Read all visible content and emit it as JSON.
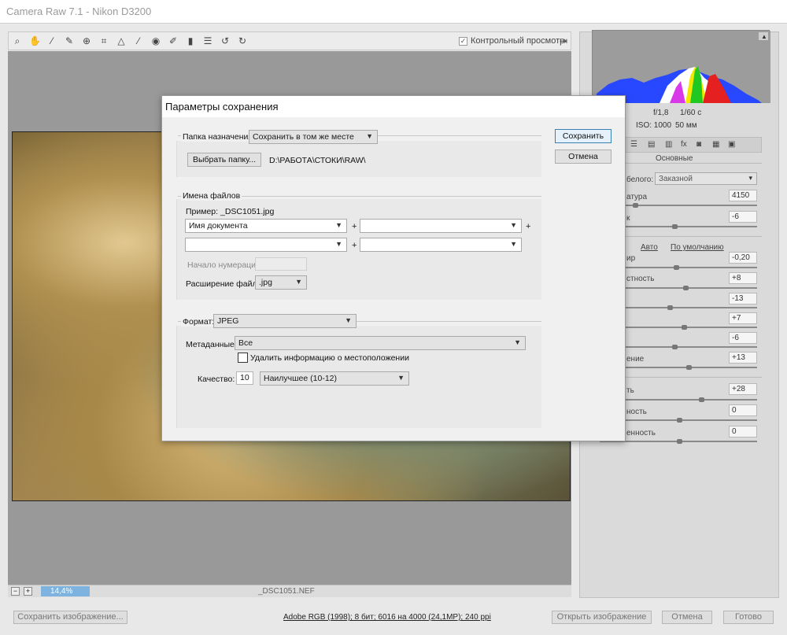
{
  "window": {
    "title": "Camera Raw 7.1  -  Nikon D3200"
  },
  "toolbar": {
    "tools": [
      "zoom-icon",
      "hand-icon",
      "eyedropper-icon",
      "color-sampler-icon",
      "target-adjust-icon",
      "crop-icon",
      "straighten-icon",
      "spot-removal-icon",
      "red-eye-icon",
      "brush-icon",
      "graduated-filter-icon",
      "preferences-icon",
      "rotate-left-icon",
      "rotate-right-icon"
    ],
    "preview_label": "Контрольный просмотр",
    "preview_checked": true
  },
  "status": {
    "zoom": "14,4%",
    "filename": "_DSC1051.NEF"
  },
  "histogram": {
    "aperture": "f/1,8",
    "shutter": "1/60 с",
    "iso": "ISO: 1000",
    "focal": "50 мм"
  },
  "panel": {
    "tab_title": "Основные",
    "wb_label": "белого:",
    "wb_value": "Заказной",
    "auto": "Авто",
    "default": "По умолчанию",
    "rows": [
      {
        "label": "атура",
        "value": "4150"
      },
      {
        "label": "к",
        "value": "-6"
      },
      {
        "label": "ир",
        "value": "-0,20"
      },
      {
        "label": "стность",
        "value": "+8"
      },
      {
        "label": "",
        "value": "-13"
      },
      {
        "label": "",
        "value": "+7"
      },
      {
        "label": "",
        "value": "-6"
      },
      {
        "label": "ение",
        "value": "+13"
      },
      {
        "label": "ть",
        "value": "+28"
      },
      {
        "label": "ность",
        "value": "0"
      },
      {
        "label": "енность",
        "value": "0"
      }
    ]
  },
  "bottom": {
    "save_image": "Сохранить изображение...",
    "info": "Adobe RGB (1998); 8 бит; 6016 на 4000 (24,1МР); 240 ppi",
    "open_image": "Открыть изображение",
    "cancel": "Отмена",
    "done": "Готово"
  },
  "dialog": {
    "title": "Параметры сохранения",
    "save": "Сохранить",
    "cancel": "Отмена",
    "dest_label": "Папка назначения:",
    "dest_value": "Сохранить в том же месте",
    "choose_folder": "Выбрать папку...",
    "folder_path": "D:\\РАБОТА\\СТОКИ\\RAW\\",
    "filenames_caption": "Имена файлов",
    "example_label": "Пример:",
    "example_value": "_DSC1051.jpg",
    "name_part1": "Имя документа",
    "name_part2": "",
    "name_part3": "",
    "name_part4": "",
    "plus": "+",
    "start_num_label": "Начало нумерации:",
    "ext_label": "Расширение файла:",
    "ext_value": ".jpg",
    "format_label": "Формат:",
    "format_value": "JPEG",
    "metadata_label": "Метаданные:",
    "metadata_value": "Все",
    "remove_location": "Удалить информацию о местоположении",
    "quality_label": "Качество:",
    "quality_num": "10",
    "quality_value": "Наилучшее  (10-12)"
  }
}
